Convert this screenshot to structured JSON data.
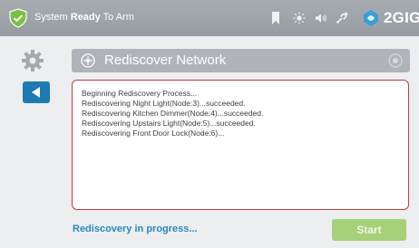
{
  "header": {
    "status_prefix": "System",
    "status_main": "Ready",
    "status_suffix": "To Arm",
    "brand": "2GIG",
    "icons": [
      "bookmark-icon",
      "brightness-icon",
      "volume-icon",
      "wrench-icon"
    ]
  },
  "page": {
    "title": "Rediscover Network"
  },
  "log": {
    "lines": [
      "Beginning Rediscovery Process...",
      "Rediscovering Night Light(Node:3)...succeeded.",
      "Rediscovering Kitchen Dimmer(Node:4)...succeeded.",
      "Rediscovering Upstairs Light(Node:5)...succeeded.",
      "Rediscovering Front Door Lock(Node:6)..."
    ]
  },
  "footer": {
    "status_text": "Rediscovery in progress...",
    "start_label": "Start"
  },
  "colors": {
    "accent_blue": "#1d7ab3",
    "border_red": "#c33d3f",
    "start_green": "#a6d07a",
    "shield_green": "#7cc043"
  }
}
